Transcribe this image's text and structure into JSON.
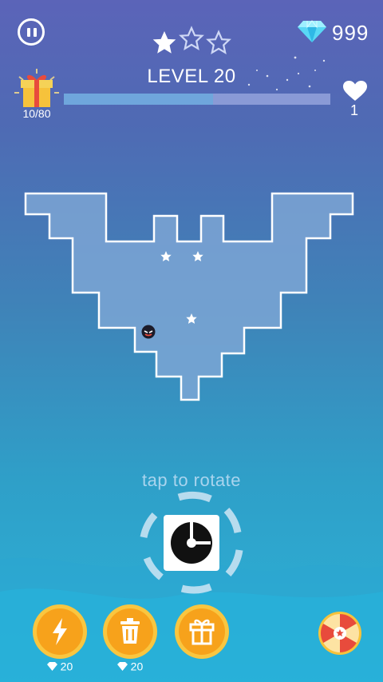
{
  "hud": {
    "level_label": "LEVEL 20",
    "stars_earned": 1,
    "stars_total": 3,
    "gems": "999",
    "gift_progress": "10/80",
    "progress_fraction": 0.56,
    "lives": "1"
  },
  "board": {
    "hint": "tap to rotate"
  },
  "powerups": [
    {
      "name": "lightning",
      "cost": "20"
    },
    {
      "name": "trash",
      "cost": "20"
    },
    {
      "name": "gift",
      "cost": ""
    }
  ],
  "colors": {
    "shape_fill": "#7fa8d6",
    "powerup_orange": "#f7a21b",
    "powerup_ring": "#f9c640",
    "gem": "#59d8f5"
  },
  "icons": [
    "pause-icon",
    "star-icon",
    "gem-icon",
    "gift-icon",
    "heart-icon",
    "lightning-icon",
    "trash-icon",
    "prize-wheel-icon",
    "rotate-knob-icon",
    "spiky-ball-icon"
  ]
}
